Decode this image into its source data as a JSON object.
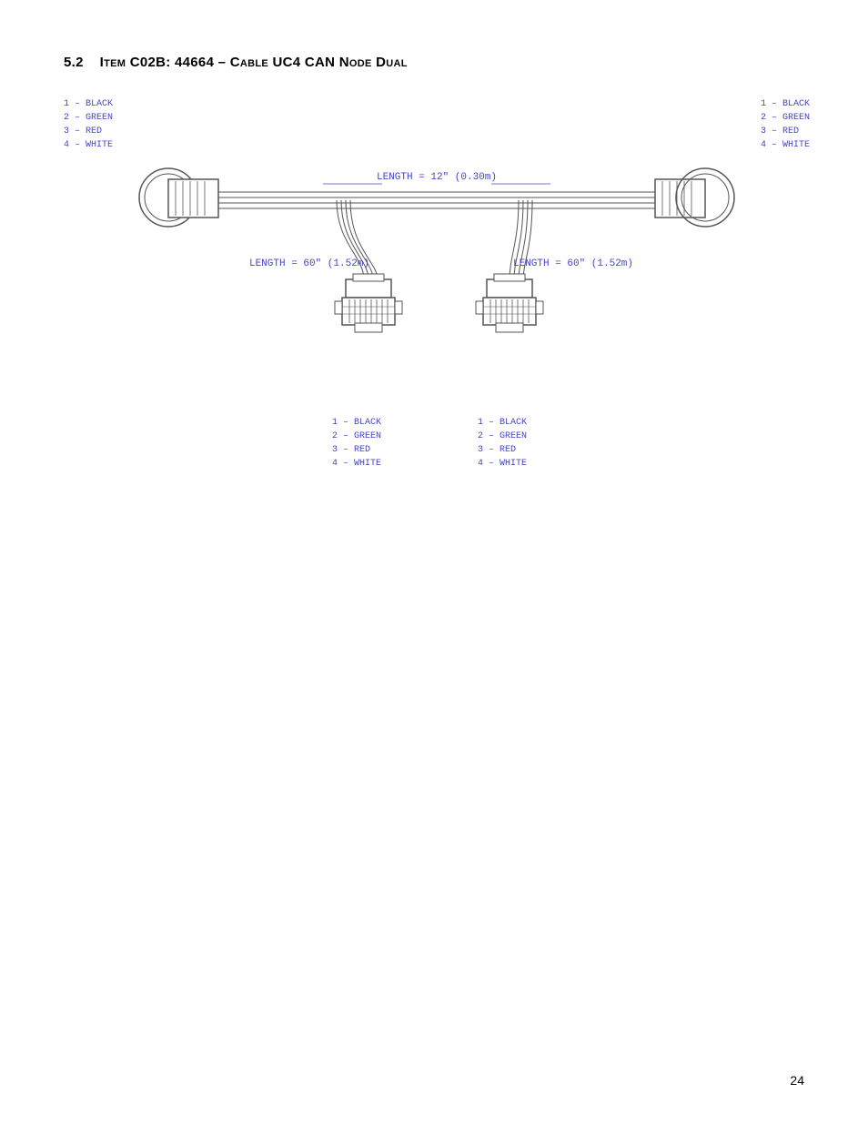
{
  "section": {
    "number": "5.2",
    "title": "Item C02B: 44664 – Cable UC4 CAN Node Dual"
  },
  "diagram": {
    "length_top": "LENGTH = 12\" (0.30m)",
    "length_bottom_left": "LENGTH = 60\" (1.52m)",
    "length_bottom_right": "LENGTH = 60\" (1.52m)",
    "wire_labels_tl": [
      "1 – BLACK",
      "2 – GREEN",
      "3 – RED",
      "4 – WHITE"
    ],
    "wire_labels_tr": [
      "1 – BLACK",
      "2 – GREEN",
      "3 – RED",
      "4 – WHITE"
    ],
    "wire_labels_bcl": [
      "1 – BLACK",
      "2 – GREEN",
      "3 – RED",
      "4 – WHITE"
    ],
    "wire_labels_bcr": [
      "1 – BLACK",
      "2 – GREEN",
      "3 – RED",
      "4 – WHITE"
    ]
  },
  "page_number": "24"
}
